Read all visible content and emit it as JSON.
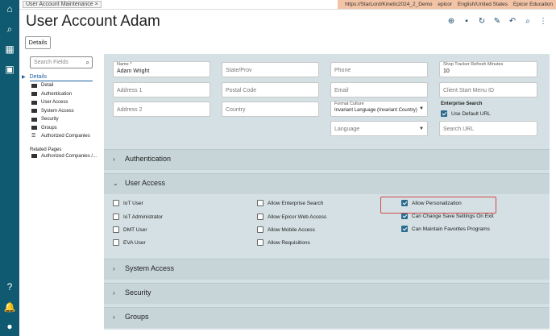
{
  "breadcrumb": "User Account Maintenance",
  "topinfo": {
    "url": "https://StarLord/Kinetic2024_2_Demo",
    "user": "epicor",
    "locale": "English/United States",
    "company": "Epicor Education"
  },
  "title": "User Account Adam",
  "details_button": "Details",
  "sidebar": {
    "search_placeholder": "Search Fields",
    "section": "Details",
    "items": [
      "Detail",
      "Authentication",
      "User Access",
      "System Access",
      "Security",
      "Groups",
      "Authorized Companies"
    ],
    "related_heading": "Related Pages",
    "related_items": [
      "Authorized Companies /..."
    ]
  },
  "form": {
    "name_label": "Name *",
    "name_value": "Adam Wright",
    "state": "State/Prov",
    "phone": "Phone",
    "shop_label": "Shop Tracker Refresh Minutes",
    "shop_value": "10",
    "address1": "Address 1",
    "postal": "Postal Code",
    "email": "Email",
    "client_menu": "Client Start Menu ID",
    "address2": "Address 2",
    "country": "Country",
    "format_label": "Format Culture",
    "format_value": "Invariant Language (Invariant Country)",
    "enterprise_heading": "Enterprise Search",
    "use_default": "Use Default URL",
    "language": "Language",
    "search_url": "Search URL"
  },
  "sections": {
    "authentication": "Authentication",
    "user_access": "User Access",
    "system_access": "System Access",
    "security": "Security",
    "groups": "Groups"
  },
  "user_access": {
    "col1": [
      "IoT User",
      "IoT Administrator",
      "DMT User",
      "EVA User"
    ],
    "col2": [
      "Allow Enterprise Search",
      "Allow Epicor Web Access",
      "Allow Mobile Access",
      "Allow Requisitions"
    ],
    "col3": [
      "Allow Personalization",
      "Can Change Save Settings On Exit",
      "Can Maintain Favorites Programs"
    ]
  },
  "colors": {
    "rail": "#0f5a70",
    "accent": "#2d6a8f",
    "highlight": "#d24a4a"
  }
}
